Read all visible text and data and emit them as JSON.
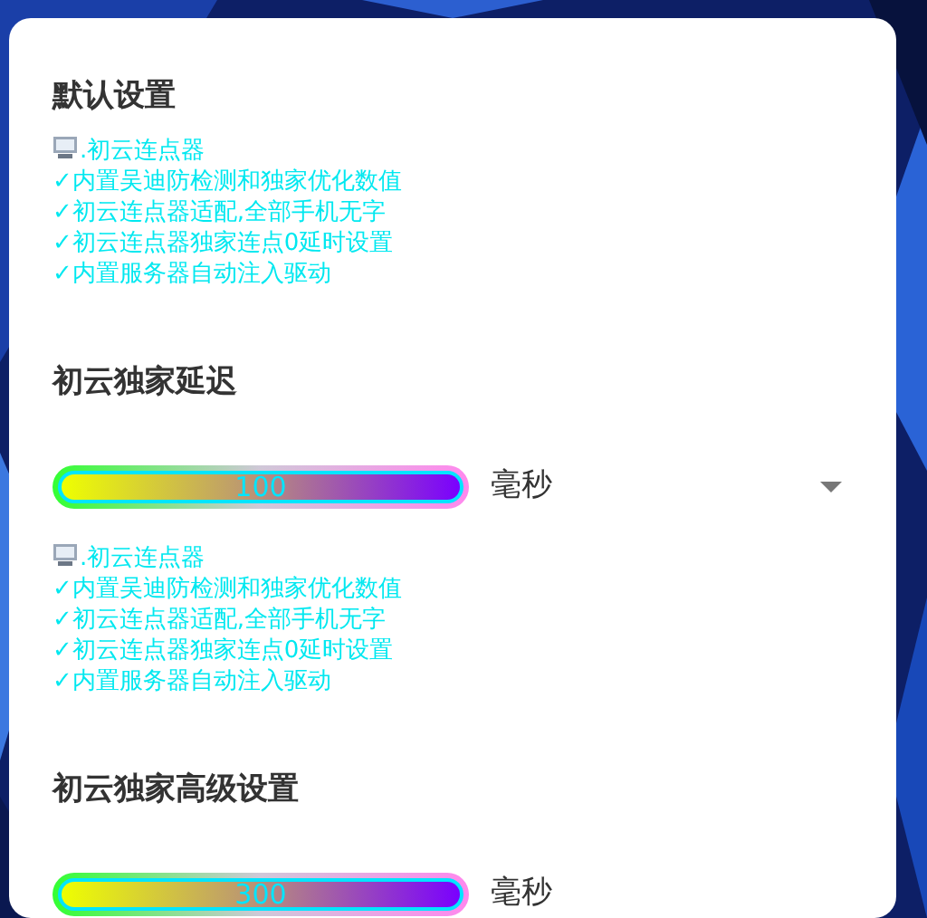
{
  "sections": [
    {
      "kind": "info",
      "title": "默认设置",
      "lines": [
        ".初云连点器",
        "✓内置吴迪防检测和独家优化数值",
        "✓初云连点器适配,全部手机无字",
        "✓初云连点器独家连点0延时设置",
        "✓内置服务器自动注入驱动"
      ]
    },
    {
      "kind": "field",
      "title": "初云独家延迟",
      "value": "100",
      "unit": "毫秒",
      "dropdown_arrow": true,
      "lines": [
        ".初云连点器",
        "✓内置吴迪防检测和独家优化数值",
        "✓初云连点器适配,全部手机无字",
        "✓初云连点器独家连点0延时设置",
        "✓内置服务器自动注入驱动"
      ]
    },
    {
      "kind": "field",
      "title": "初云独家高级设置",
      "value": "300",
      "unit": "毫秒",
      "dropdown_arrow": false
    }
  ]
}
